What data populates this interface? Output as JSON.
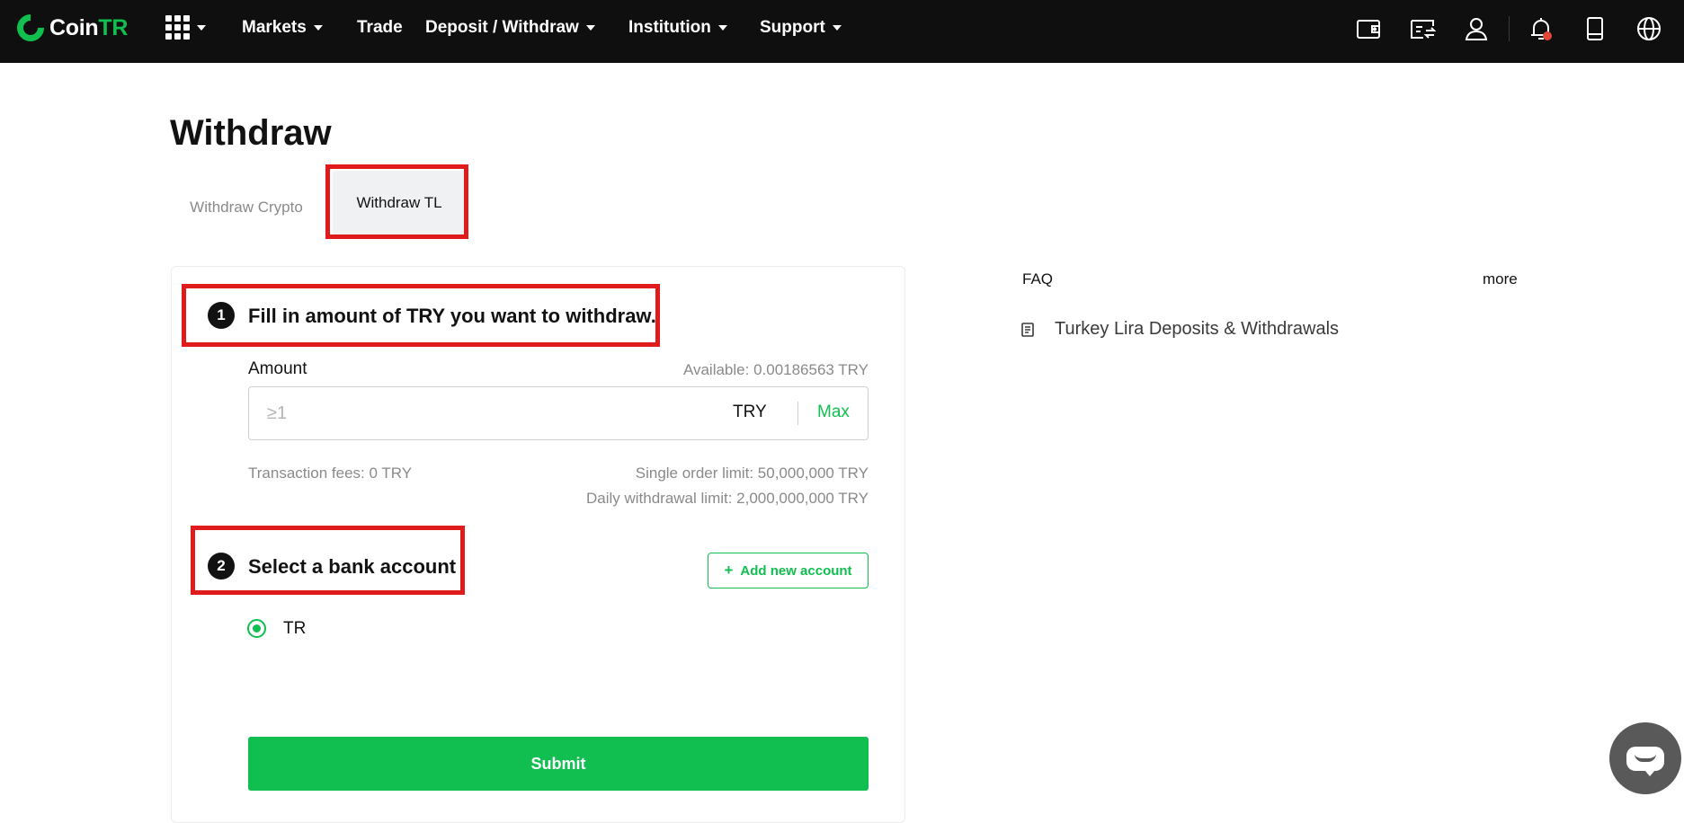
{
  "nav": {
    "logo_text": "Coin",
    "logo_text_accent": "TR",
    "items": [
      {
        "label": "Markets"
      },
      {
        "label": "Trade"
      },
      {
        "label": "Deposit / Withdraw"
      },
      {
        "label": "Institution"
      },
      {
        "label": "Support"
      }
    ],
    "icons": [
      "wallet-icon",
      "orders-icon",
      "user-icon",
      "bell-icon",
      "mobile-icon",
      "globe-icon"
    ]
  },
  "page": {
    "title": "Withdraw",
    "tabs": [
      {
        "label": "Withdraw Crypto",
        "active": false
      },
      {
        "label": "Withdraw TL",
        "active": true
      }
    ]
  },
  "step1": {
    "number": "1",
    "title": "Fill in amount of TRY you want to withdraw.",
    "amount_label": "Amount",
    "available": "Available: 0.00186563 TRY",
    "input_placeholder": "≥1",
    "unit": "TRY",
    "max_label": "Max",
    "fee": "Transaction fees: 0 TRY",
    "single_limit": "Single order limit: 50,000,000 TRY",
    "daily_limit": "Daily withdrawal limit: 2,000,000,000 TRY"
  },
  "step2": {
    "number": "2",
    "title": "Select a bank account",
    "add_account_label": "Add new account",
    "accounts": [
      {
        "label": "TR",
        "selected": true
      }
    ]
  },
  "submit_label": "Submit",
  "faq": {
    "title": "FAQ",
    "more_label": "more",
    "items": [
      {
        "label": "Turkey Lira Deposits & Withdrawals"
      }
    ]
  },
  "colors": {
    "accent": "#10bf4f",
    "nav_bg": "#0f0f0f",
    "highlight": "#e01b1b",
    "notification_dot": "#e0483a"
  }
}
